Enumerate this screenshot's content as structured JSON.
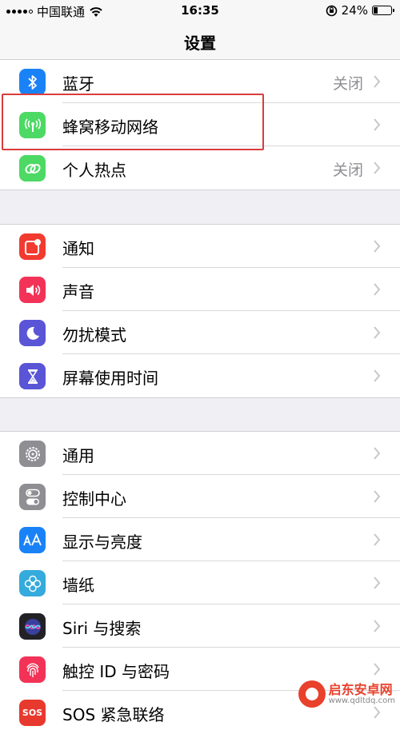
{
  "status_bar": {
    "carrier": "中国联通",
    "time": "16:35",
    "battery": "24%",
    "battery_level": 0.24
  },
  "nav": {
    "title": "设置"
  },
  "groups": [
    {
      "rows": [
        {
          "label": "蓝牙",
          "value": "关闭",
          "icon": "bluetooth-icon",
          "color": "#1a82f7"
        },
        {
          "label": "蜂窝移动网络",
          "value": "",
          "icon": "cellular-icon",
          "color": "#4cd964"
        },
        {
          "label": "个人热点",
          "value": "关闭",
          "icon": "hotspot-icon",
          "color": "#4cd964"
        }
      ]
    },
    {
      "rows": [
        {
          "label": "通知",
          "value": "",
          "icon": "notifications-icon",
          "color": "#f23b30"
        },
        {
          "label": "声音",
          "value": "",
          "icon": "sound-icon",
          "color": "#f23357"
        },
        {
          "label": "勿扰模式",
          "value": "",
          "icon": "moon-icon",
          "color": "#5a55d6"
        },
        {
          "label": "屏幕使用时间",
          "value": "",
          "icon": "hourglass-icon",
          "color": "#5a55d6"
        }
      ]
    },
    {
      "rows": [
        {
          "label": "通用",
          "value": "",
          "icon": "gear-icon",
          "color": "#8e8e93"
        },
        {
          "label": "控制中心",
          "value": "",
          "icon": "toggles-icon",
          "color": "#8e8e93"
        },
        {
          "label": "显示与亮度",
          "value": "",
          "icon": "display-icon",
          "color": "#1a82f7"
        },
        {
          "label": "墙纸",
          "value": "",
          "icon": "wallpaper-icon",
          "color": "#35aadc"
        },
        {
          "label": "Siri 与搜索",
          "value": "",
          "icon": "siri-icon",
          "color": "#222226"
        },
        {
          "label": "触控 ID 与密码",
          "value": "",
          "icon": "fingerprint-icon",
          "color": "#f23357"
        },
        {
          "label": "SOS 紧急联络",
          "value": "",
          "icon": "sos-icon",
          "color": "#e8392e"
        }
      ]
    }
  ],
  "watermark": {
    "name": "启东安卓网",
    "url": "www.qdltdq.com"
  }
}
